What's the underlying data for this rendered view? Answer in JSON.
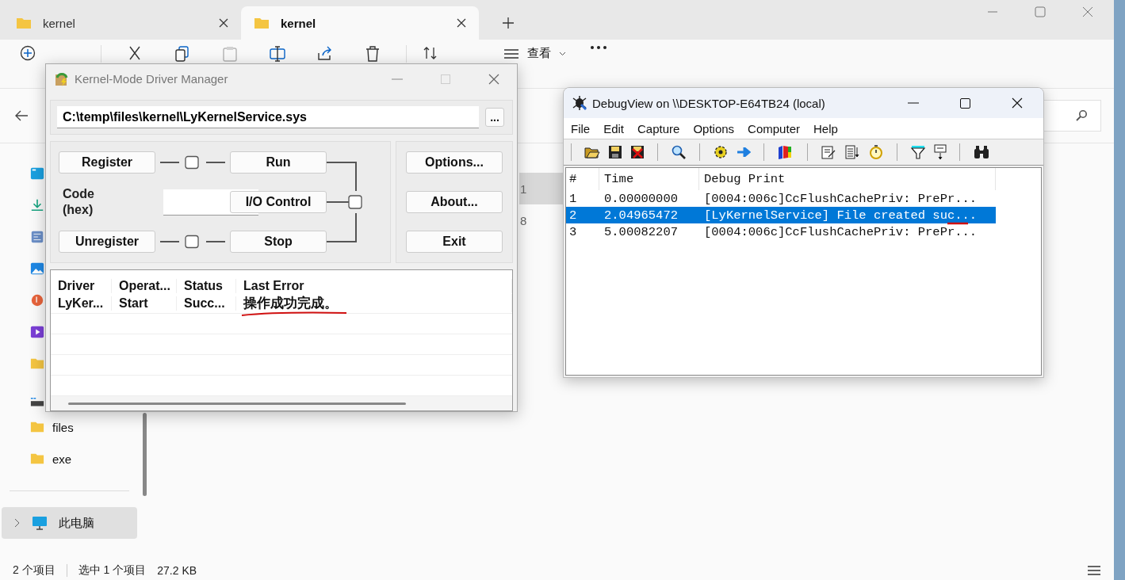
{
  "explorer": {
    "tabs": [
      {
        "label": "kernel",
        "selected": false
      },
      {
        "label": "kernel",
        "selected": true
      }
    ],
    "actions": [
      {
        "kind": "cut",
        "disabled": false
      },
      {
        "kind": "copy",
        "disabled": false
      },
      {
        "kind": "paste",
        "disabled": true
      },
      {
        "kind": "rename",
        "disabled": false
      },
      {
        "kind": "share",
        "disabled": false
      },
      {
        "kind": "delete",
        "disabled": false
      }
    ],
    "view_button": {
      "label": "查看"
    },
    "sidebar": {
      "items": [
        {
          "kind": "desktop",
          "selected": false
        },
        {
          "kind": "downloads",
          "selected": false
        },
        {
          "kind": "documents",
          "selected": false
        },
        {
          "kind": "pictures",
          "selected": false
        },
        {
          "kind": "music",
          "selected": false
        },
        {
          "kind": "videos",
          "selected": false
        },
        {
          "kind": "folder",
          "selected": false
        },
        {
          "kind": "drive",
          "selected": false
        },
        {
          "kind": "folder",
          "label": "files",
          "selected": false
        },
        {
          "kind": "folder",
          "label": "exe",
          "selected": false
        }
      ],
      "this_pc": {
        "label": "此电脑",
        "selected": true
      }
    },
    "content_rows": [
      {
        "text": "1",
        "selected": true
      },
      {
        "text": "8",
        "selected": false
      }
    ],
    "status_bar": {
      "count": "2 个项目",
      "selection": "选中 1 个项目",
      "size": "27.2 KB"
    }
  },
  "driver_manager": {
    "title": "Kernel-Mode Driver Manager",
    "path": "C:\\temp\\files\\kernel\\LyKernelService.sys",
    "browse_label": "...",
    "left_buttons": [
      "Register",
      "Unregister"
    ],
    "code_label": "Code\n(hex)",
    "middle_buttons": [
      "Run",
      "I/O Control",
      "Stop"
    ],
    "right_buttons": [
      "Options...",
      "About...",
      "Exit"
    ],
    "columns": [
      "Driver",
      "Operat...",
      "Status",
      "Last Error"
    ],
    "rows": [
      [
        "LyKer...",
        "Start",
        "Succ...",
        "操作成功完成。"
      ]
    ]
  },
  "debugview": {
    "title": "DebugView on \\\\DESKTOP-E64TB24 (local)",
    "menu": [
      "File",
      "Edit",
      "Capture",
      "Options",
      "Computer",
      "Help"
    ],
    "columns": [
      "#",
      "Time",
      "Debug Print"
    ],
    "rows": [
      {
        "num": "1",
        "time": "0.00000000",
        "text": "[0004:006c]CcFlushCachePriv: PrePr...",
        "selected": false
      },
      {
        "num": "2",
        "time": "2.04965472",
        "text": "[LyKernelService] File created suc...",
        "selected": true
      },
      {
        "num": "3",
        "time": "5.00082207",
        "text": "[0004:006c]CcFlushCachePriv: PrePr...",
        "selected": false
      }
    ]
  }
}
